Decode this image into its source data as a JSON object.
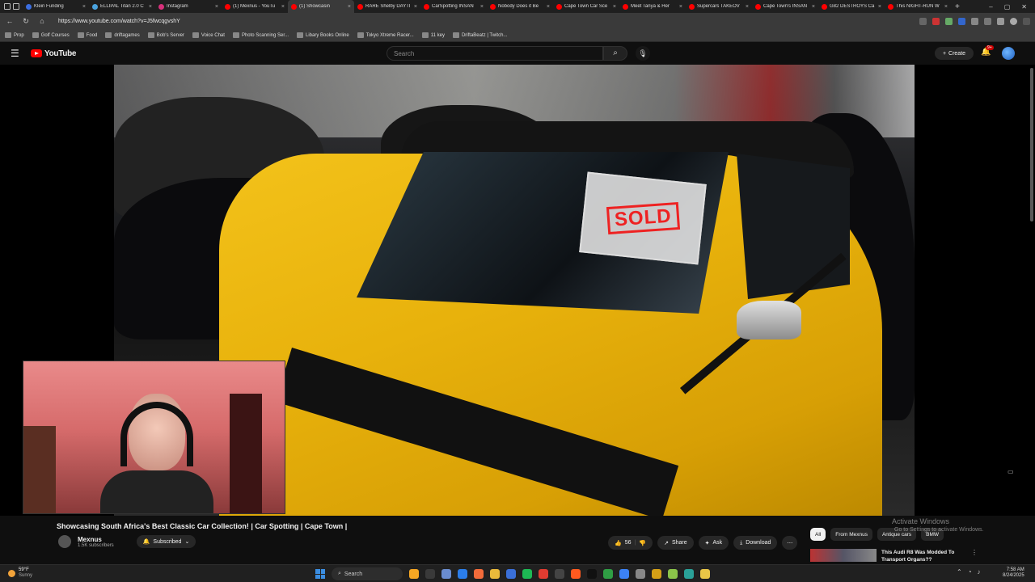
{
  "browser": {
    "tabs": [
      {
        "title": "Klein Funding",
        "color": "#3b6ee0"
      },
      {
        "title": "ELLIPAL Titan 2.0 C",
        "color": "#4aa3df"
      },
      {
        "title": "Instagram",
        "color": "#d6307a"
      },
      {
        "title": "(1) Mexnus - YouTu",
        "color": "#ff0000"
      },
      {
        "title": "(1) Showcasin",
        "color": "#ff0000",
        "active": true
      },
      {
        "title": "RARE Shelby DAYTI",
        "color": "#ff0000"
      },
      {
        "title": "CarSpotting INSAN",
        "color": "#ff0000"
      },
      {
        "title": "Nobody Does it Be",
        "color": "#ff0000"
      },
      {
        "title": "Cape Town Car Sce",
        "color": "#ff0000"
      },
      {
        "title": "Meet Tanya & Her",
        "color": "#ff0000"
      },
      {
        "title": "Supercars TAKEOV",
        "color": "#ff0000"
      },
      {
        "title": "Cape Town's INSAN",
        "color": "#ff0000"
      },
      {
        "title": "G82 DESTROYS Ca",
        "color": "#ff0000"
      },
      {
        "title": "This NIGHT-RUN W",
        "color": "#ff0000"
      }
    ],
    "url": "https://www.youtube.com/watch?v=J5fwcqgvshY",
    "bookmarks": [
      "Prop",
      "Golf Courses",
      "Food",
      "driftagames",
      "Bob's Server",
      "Voice Chat",
      "Photo Scanning Ser...",
      "Libary Books Online",
      "Tokyo Xtreme Racer...",
      "11 key",
      "DriftaBeatz | Twitch..."
    ]
  },
  "youtube": {
    "logo_text": "YouTube",
    "search_placeholder": "Search",
    "create_label": "Create",
    "notification_count": "9+"
  },
  "video": {
    "sold_sign": "SOLD",
    "title": "Showcasing South Africa's Best Classic Car Collection! | Car Spotting | Cape Town |",
    "channel_name": "Mexnus",
    "subscribers": "1.5K subscribers",
    "subscribed_label": "Subscribed",
    "likes": "56",
    "share_label": "Share",
    "ask_label": "Ask",
    "download_label": "Download"
  },
  "chips": [
    "All",
    "From Mexnus",
    "Antique cars",
    "BMW"
  ],
  "recommendation": {
    "title": "This Audi R8 Was Modded To Transport Organs??"
  },
  "watermark": {
    "line1": "Activate Windows",
    "line2": "Go to Settings to activate Windows."
  },
  "taskbar": {
    "temp": "59°F",
    "condition": "Sunny",
    "search_label": "Search",
    "time": "7:58 AM",
    "date": "8/24/2025",
    "apps": [
      "#f5a623",
      "#3a3a3a",
      "#6a8ccf",
      "#2b7de9",
      "#f26b3a",
      "#e9b93b",
      "#3a6fd8",
      "#1db954",
      "#e03c31",
      "#444",
      "#ff5a1f",
      "#111",
      "#2f9e44",
      "#3c82f6",
      "#888",
      "#d4a017",
      "#8bc34a",
      "#2aa198",
      "#e8c547"
    ]
  }
}
